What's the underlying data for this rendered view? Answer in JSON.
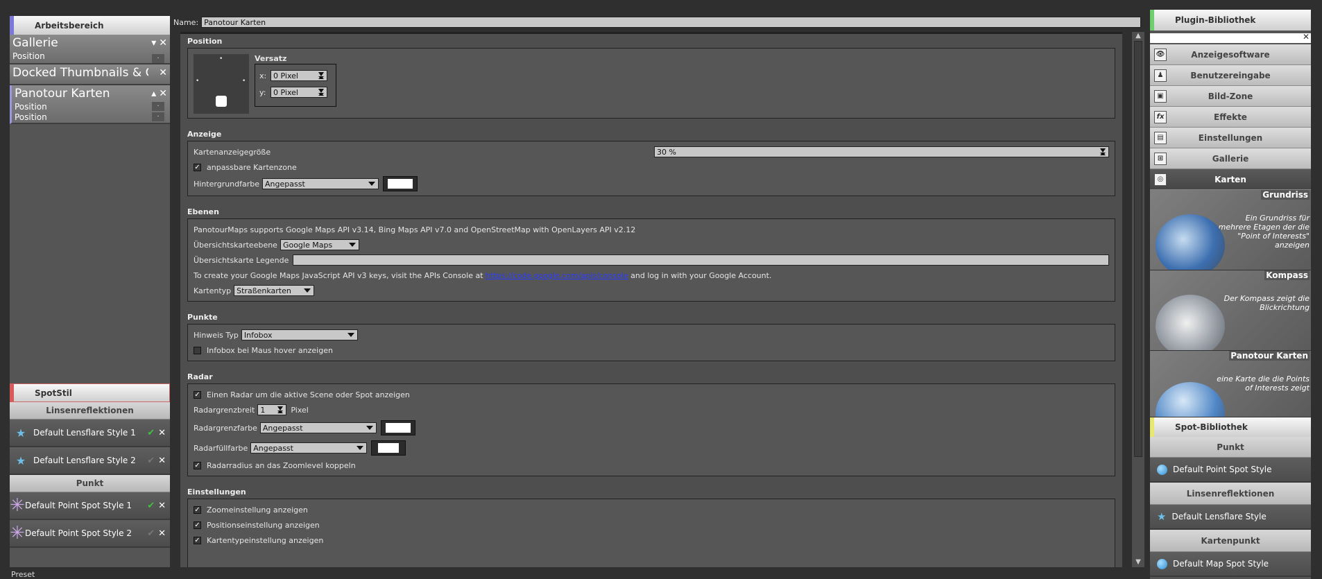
{
  "workspace": {
    "header": "Arbeitsbereich",
    "items": [
      {
        "title": "Gallerie",
        "sub": [
          "Position"
        ]
      },
      {
        "title": "Docked Thumbnails & Cont",
        "sub": []
      },
      {
        "title": "Panotour Karten",
        "sub": [
          "Position",
          "Position"
        ]
      }
    ]
  },
  "spotstil": {
    "header": "SpotStil",
    "group1": "Linsenreflektionen",
    "lens": [
      "Default Lensflare Style 1",
      "Default Lensflare Style 2"
    ],
    "group2": "Punkt",
    "points": [
      "Default Point Spot Style 1",
      "Default Point Spot Style 2"
    ]
  },
  "footer": {
    "preset": "Preset"
  },
  "name_field": {
    "label": "Name:",
    "value": "Panotour Karten"
  },
  "position": {
    "title": "Position",
    "versatz": "Versatz",
    "x_label": "x:",
    "x_value": "0 Pixel",
    "y_label": "y:",
    "y_value": "0 Pixel"
  },
  "anzeige": {
    "title": "Anzeige",
    "size_label": "Kartenanzeigegröße",
    "size_value": "30 %",
    "adjustable": "anpassbare Kartenzone",
    "bg_label": "Hintergrundfarbe",
    "bg_value": "Angepasst"
  },
  "ebenen": {
    "title": "Ebenen",
    "info": "PanotourMaps supports Google Maps API v3.14, Bing Maps API v7.0 and OpenStreetMap with OpenLayers API v2.12",
    "overview_label": "Übersichtskarteebene",
    "overview_value": "Google Maps",
    "legend_label": "Übersichtskarte Legende",
    "key_text_pre": "To create your Google Maps JavaScript API v3 keys, visit the APIs Console at ",
    "key_link": "https://code.google.com/apis/console",
    "key_text_post": " and log in with your Google Account.",
    "maptype_label": "Kartentyp",
    "maptype_value": "Straßenkarten"
  },
  "punkte": {
    "title": "Punkte",
    "hint_label": "Hinweis Typ",
    "hint_value": "Infobox",
    "hover": "Infobox bei Maus hover anzeigen"
  },
  "radar": {
    "title": "Radar",
    "show": "Einen Radar um die aktive Scene oder Spot anzeigen",
    "width_label": "Radargrenzbreit",
    "width_value": "1",
    "width_unit": "Pixel",
    "border_label": "Radargrenzfarbe",
    "border_value": "Angepasst",
    "fill_label": "Radarfüllfarbe",
    "fill_value": "Angepasst",
    "zoom": "Radarradius an das Zoomlevel koppeln"
  },
  "einstellungen": {
    "title": "Einstellungen",
    "items": [
      "Zoomeinstellung anzeigen",
      "Positionseinstellung anzeigen",
      "Kartentypeinstellung anzeigen"
    ]
  },
  "plugins": {
    "header": "Plugin-Bibliothek",
    "items": [
      {
        "label": "Anzeigesoftware",
        "icon": "eye-icon",
        "glyph": "👁"
      },
      {
        "label": "Benutzereingabe",
        "icon": "person-icon",
        "glyph": "♟"
      },
      {
        "label": "Bild-Zone",
        "icon": "image-zone-icon",
        "glyph": "▣"
      },
      {
        "label": "Effekte",
        "icon": "fx-icon",
        "glyph": "fx"
      },
      {
        "label": "Einstellungen",
        "icon": "settings-icon",
        "glyph": "▤"
      },
      {
        "label": "Gallerie",
        "icon": "gallery-icon",
        "glyph": "⊞"
      },
      {
        "label": "Karten",
        "icon": "globe-icon",
        "glyph": "◎"
      }
    ],
    "cards": [
      {
        "title": "Grundriss",
        "desc": "Ein Grundriss für mehrere Etagen der die \"Point of Interests\" anzeigen"
      },
      {
        "title": "Kompass",
        "desc": "Der Kompass zeigt die Blickrichtung"
      },
      {
        "title": "Panotour Karten",
        "desc": "eine Karte die die Points of Interests zeigt"
      }
    ]
  },
  "spotlib": {
    "header": "Spot-Bibliothek",
    "g1": "Punkt",
    "i1": "Default Point Spot Style",
    "g2": "Linsenreflektionen",
    "i2": "Default Lensflare Style",
    "g3": "Kartenpunkt",
    "i3": "Default Map Spot Style"
  },
  "colors": {
    "workspace_accent": "#7a78d8",
    "spotstil_accent": "#d85a5a",
    "plugin_accent": "#6fcf6f",
    "spotlib_accent": "#e8e870"
  }
}
